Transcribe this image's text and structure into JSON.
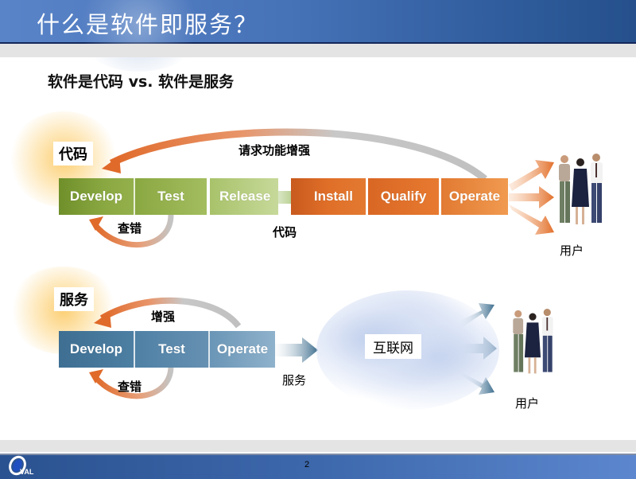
{
  "header": {
    "title": "什么是软件即服务？"
  },
  "subtitle": "软件是代码 vs. 软件是服务",
  "code_model": {
    "tag": "代码",
    "feedback_label": "请求功能增强",
    "debug_label": "查错",
    "output_label": "代码",
    "users_label": "用户",
    "stages": [
      {
        "label": "Develop",
        "phase": "development",
        "color": "#8aa842"
      },
      {
        "label": "Test",
        "phase": "development",
        "color": "#94b04c"
      },
      {
        "label": "Release",
        "phase": "development",
        "color": "#b4cb80"
      },
      {
        "label": "Install",
        "phase": "customer",
        "color": "#e06f28"
      },
      {
        "label": "Qualify",
        "phase": "customer",
        "color": "#e27530"
      },
      {
        "label": "Operate",
        "phase": "customer",
        "color": "#ec8c44"
      }
    ]
  },
  "service_model": {
    "tag": "服务",
    "feedback_label": "增强",
    "debug_label": "查错",
    "output_label": "服务",
    "network_label": "互联网",
    "users_label": "用户",
    "stages": [
      {
        "label": "Develop",
        "color": "#4d7fa3"
      },
      {
        "label": "Test",
        "color": "#5c89ad"
      },
      {
        "label": "Operate",
        "color": "#7aa2c0"
      }
    ]
  },
  "colors": {
    "header_blue": "#3d68ac",
    "feedback_arrow": "#e06a2a",
    "green_arrow": "#7fa83a",
    "blue_arrow": "#3f6f8f",
    "orange_arrow": "#e2702c"
  },
  "footer": {
    "page_number": "2",
    "logo_text": "VAL"
  }
}
